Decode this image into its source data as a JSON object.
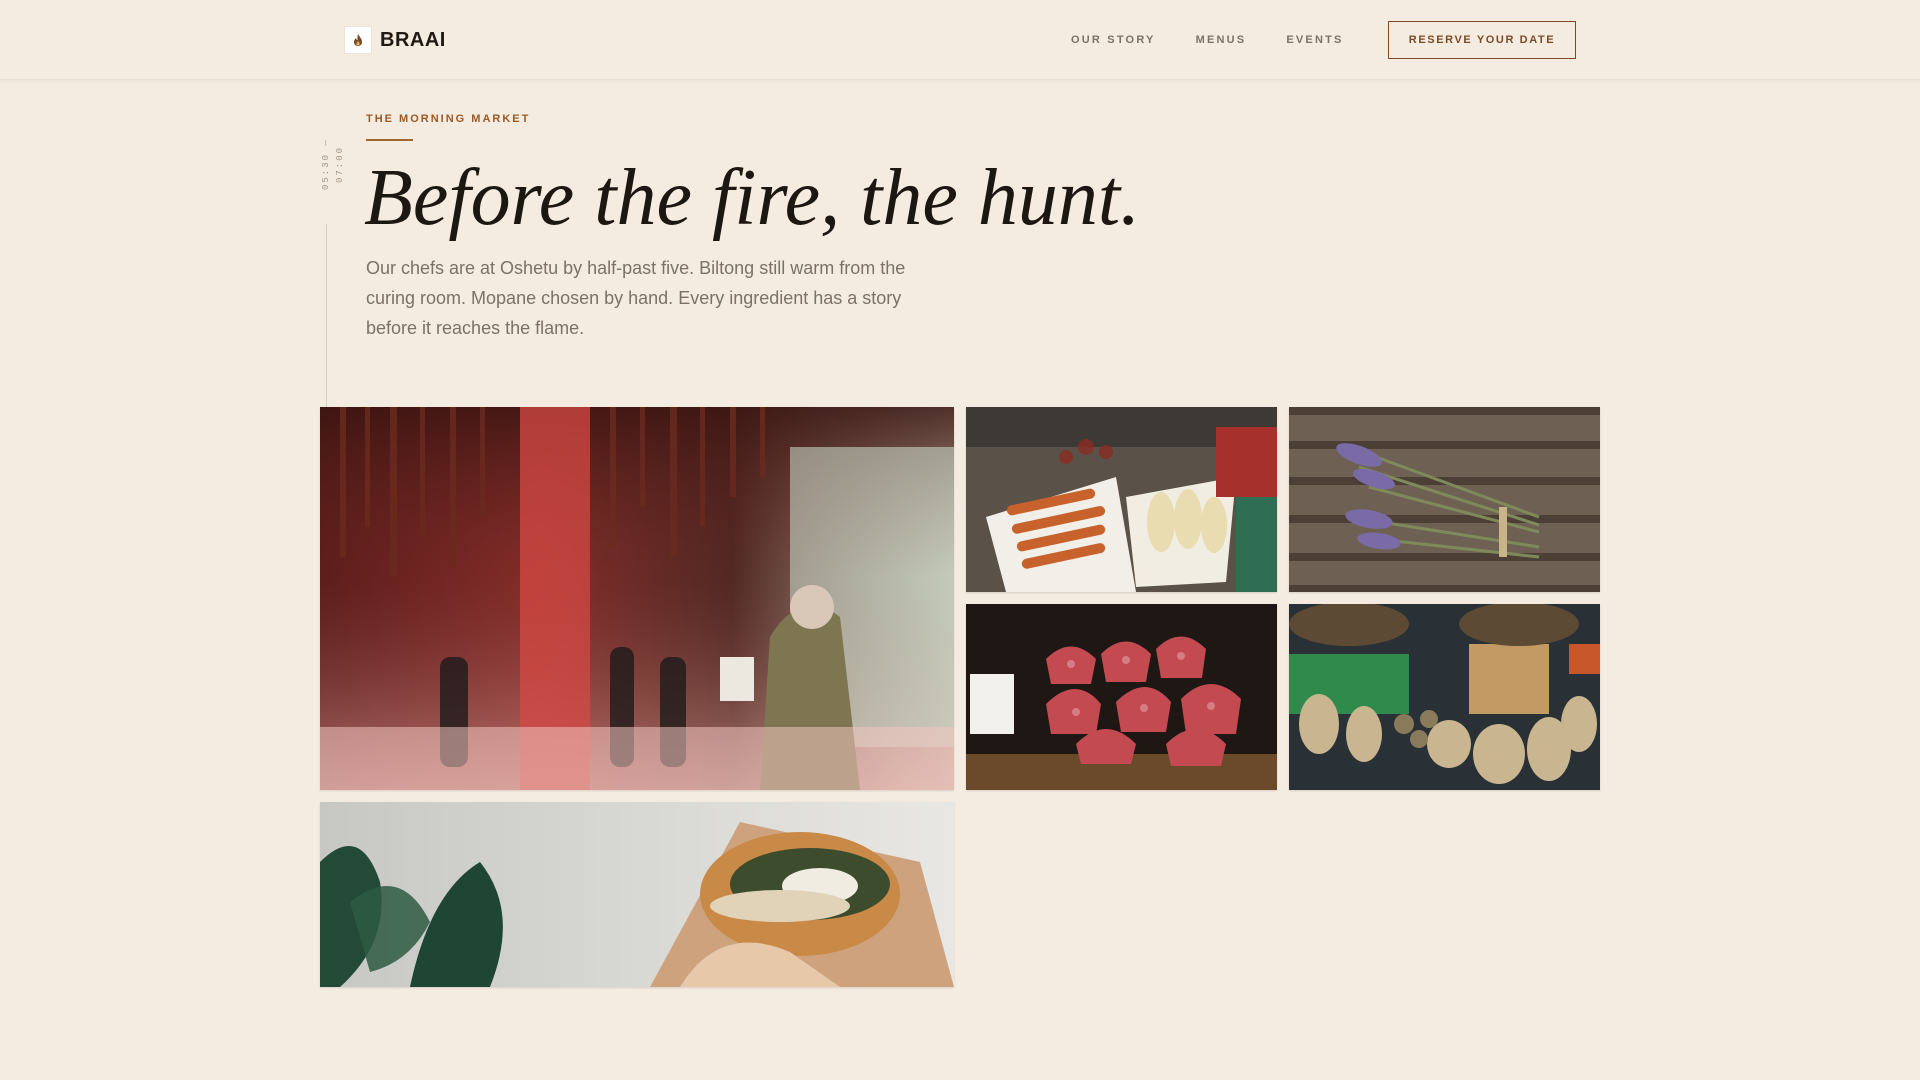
{
  "brand": {
    "name": "BRAAI",
    "logo_icon": "flame-icon",
    "accent": "#9a5a26"
  },
  "nav": {
    "links": [
      "OUR STORY",
      "MENUS",
      "EVENTS"
    ],
    "cta": "RESERVE YOUR DATE"
  },
  "timeline": {
    "label": "05:30 — 07:00"
  },
  "section": {
    "eyebrow": "THE MORNING MARKET",
    "headline": "Before the fire, the hunt.",
    "body": "Our chefs are at Oshetu by half-past five. Biltong still warm from the curing room. Mopane chosen by hand. Every ingredient has a story before it reaches the flame."
  },
  "gallery": {
    "photos": [
      "market-hall-photo",
      "vegetable-crates-photo",
      "lavender-bundles-photo",
      "raw-steak-photo",
      "root-baskets-photo",
      "stuffed-bun-photo"
    ]
  },
  "colors": {
    "background": "#f5ece1",
    "text": "#1d1711",
    "muted": "#7b7168",
    "button_border": "#7a4a26"
  }
}
